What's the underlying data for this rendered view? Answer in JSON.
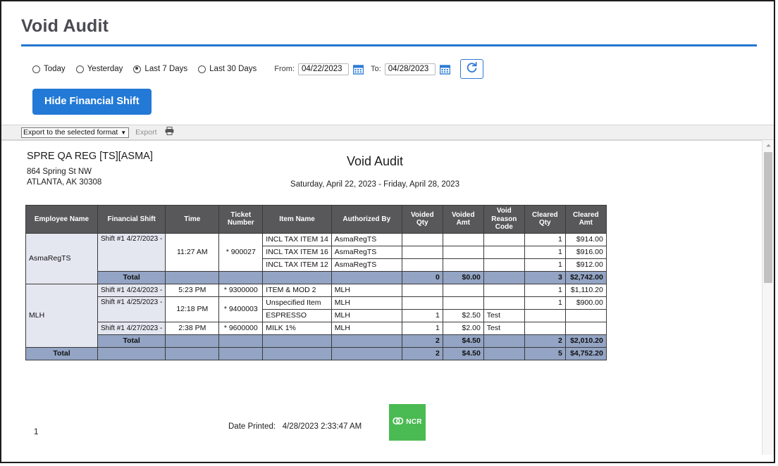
{
  "page": {
    "title": "Void Audit",
    "accent_color": "#2476cf"
  },
  "filters": {
    "radios": [
      {
        "label": "Today",
        "selected": false
      },
      {
        "label": "Yesterday",
        "selected": false
      },
      {
        "label": "Last 7 Days",
        "selected": true
      },
      {
        "label": "Last 30 Days",
        "selected": false
      }
    ],
    "from_label": "From:",
    "from_value": "04/22/2023",
    "to_label": "To:",
    "to_value": "04/28/2023",
    "refresh_icon": "refresh-icon",
    "calendar_icon": "calendar-icon"
  },
  "actions": {
    "hide_financial_shift": "Hide Financial Shift"
  },
  "export_toolbar": {
    "select_value": "Export to the selected format",
    "export_label": "Export",
    "print_icon": "printer-icon"
  },
  "report": {
    "store_name": "SPRE QA REG [TS][ASMA]",
    "store_address_1": "864 Spring St NW",
    "store_address_2": "ATLANTA, AK 30308",
    "title": "Void Audit",
    "date_range": "Saturday, April 22, 2023 - Friday, April 28, 2023",
    "columns": [
      "Employee Name",
      "Financial Shift",
      "Time",
      "Ticket Number",
      "Item Name",
      "Authorized By",
      "Voided Qty",
      "Voided Amt",
      "Void Reason Code",
      "Cleared Qty",
      "Cleared Amt"
    ],
    "rows": [
      {
        "employee": "AsmaRegTS",
        "shift": "Shift #1 4/27/2023 -",
        "time": "11:27 AM",
        "ticket": "* 900027",
        "item": "INCL TAX ITEM 14",
        "authorized_by": "AsmaRegTS",
        "voided_qty": "",
        "voided_amt": "",
        "void_reason": "",
        "cleared_qty": "1",
        "cleared_amt": "$914.00"
      },
      {
        "employee": "",
        "shift": "",
        "time": "",
        "ticket": "",
        "item": "INCL TAX ITEM 16",
        "authorized_by": "AsmaRegTS",
        "voided_qty": "",
        "voided_amt": "",
        "void_reason": "",
        "cleared_qty": "1",
        "cleared_amt": "$916.00"
      },
      {
        "employee": "",
        "shift": "",
        "time": "",
        "ticket": "",
        "item": "INCL TAX ITEM 12",
        "authorized_by": "AsmaRegTS",
        "voided_qty": "",
        "voided_amt": "",
        "void_reason": "",
        "cleared_qty": "1",
        "cleared_amt": "$912.00"
      },
      {
        "employee": "MLH",
        "shift": "Shift #1 4/24/2023 -",
        "time": "5:23 PM",
        "ticket": "* 9300000",
        "item": "ITEM & MOD 2",
        "authorized_by": "MLH",
        "voided_qty": "",
        "voided_amt": "",
        "void_reason": "",
        "cleared_qty": "1",
        "cleared_amt": "$1,110.20"
      },
      {
        "employee": "",
        "shift": "Shift #1 4/25/2023 -",
        "time": "12:18 PM",
        "ticket": "* 9400003",
        "item": "Unspecified Item",
        "authorized_by": "MLH",
        "voided_qty": "",
        "voided_amt": "",
        "void_reason": "",
        "cleared_qty": "1",
        "cleared_amt": "$900.00"
      },
      {
        "employee": "",
        "shift": "",
        "time": "",
        "ticket": "",
        "item": "ESPRESSO",
        "authorized_by": "MLH",
        "voided_qty": "1",
        "voided_amt": "$2.50",
        "void_reason": "Test",
        "cleared_qty": "",
        "cleared_amt": ""
      },
      {
        "employee": "",
        "shift": "Shift #1 4/27/2023 -",
        "time": "2:38 PM",
        "ticket": "* 9600000",
        "item": "MILK 1%",
        "authorized_by": "MLH",
        "voided_qty": "1",
        "voided_amt": "$2.00",
        "void_reason": "Test",
        "cleared_qty": "",
        "cleared_amt": ""
      }
    ],
    "totals": {
      "label": "Total",
      "group_1": {
        "voided_qty": "0",
        "voided_amt": "$0.00",
        "void_reason": "",
        "cleared_qty": "3",
        "cleared_amt": "$2,742.00"
      },
      "group_2": {
        "voided_qty": "2",
        "voided_amt": "$4.50",
        "void_reason": "",
        "cleared_qty": "2",
        "cleared_amt": "$2,010.20"
      },
      "grand": {
        "voided_qty": "2",
        "voided_amt": "$4.50",
        "void_reason": "",
        "cleared_qty": "5",
        "cleared_amt": "$4,752.20"
      }
    },
    "footer": {
      "page_number": "1",
      "date_printed_label": "Date Printed:",
      "date_printed_value": "4/28/2023 2:33:47 AM",
      "logo_text": "NCR",
      "logo_color": "#4aba53"
    }
  }
}
